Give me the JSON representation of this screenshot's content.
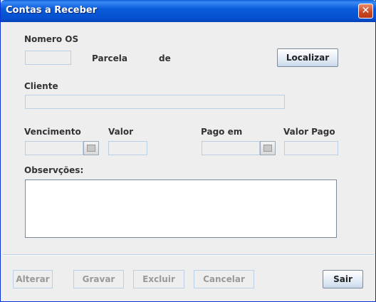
{
  "window": {
    "title": "Contas a Receber",
    "close_glyph": "✕"
  },
  "form": {
    "numero_os_label": "Nomero OS",
    "parcela_label": "Parcela",
    "de_label": "de",
    "localizar_button": "Localizar",
    "cliente_label": "Cliente",
    "vencimento_label": "Vencimento",
    "valor_label": "Valor",
    "pago_em_label": "Pago em",
    "valor_pago_label": "Valor Pago",
    "observacoes_label": "Observções:"
  },
  "footer": {
    "alterar": "Alterar",
    "gravar": "Gravar",
    "excluir": "Excluir",
    "cancelar": "Cancelar",
    "sair": "Sair"
  },
  "icons": {
    "calendar": "calendar-icon",
    "close": "close-icon"
  }
}
